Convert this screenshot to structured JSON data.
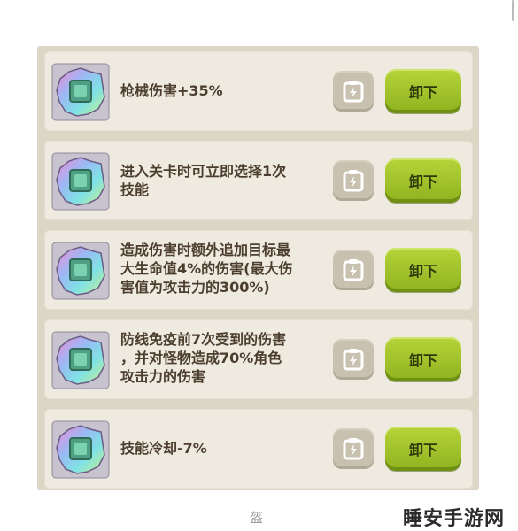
{
  "items": [
    {
      "description": "枪械伤害+35%",
      "button_label": "卸下",
      "gem_icon": "gem-icon",
      "lock_icon": "lock-icon"
    },
    {
      "description": "进入关卡时可立即选择1次\n技能",
      "button_label": "卸下",
      "gem_icon": "gem-icon",
      "lock_icon": "lock-icon"
    },
    {
      "description": "造成伤害时额外追加目标最\n大生命值4%的伤害(最大伤\n害值为攻击力的300%)",
      "button_label": "卸下",
      "gem_icon": "gem-icon",
      "lock_icon": "lock-icon"
    },
    {
      "description": "防线免疫前7次受到的伤害\n，并对怪物造成70%角色\n攻击力的伤害",
      "button_label": "卸下",
      "gem_icon": "gem-icon",
      "lock_icon": "lock-icon"
    },
    {
      "description": "技能冷却-7%",
      "button_label": "卸下",
      "gem_icon": "gem-icon",
      "lock_icon": "lock-icon"
    }
  ],
  "footer": {
    "char": "盔"
  },
  "watermark": {
    "text": "睡安手游网"
  },
  "colors": {
    "panel": "#dcd6c6",
    "card": "#efeadf",
    "button_green": "#9cbf24",
    "text_brown": "#4b3e2f"
  }
}
